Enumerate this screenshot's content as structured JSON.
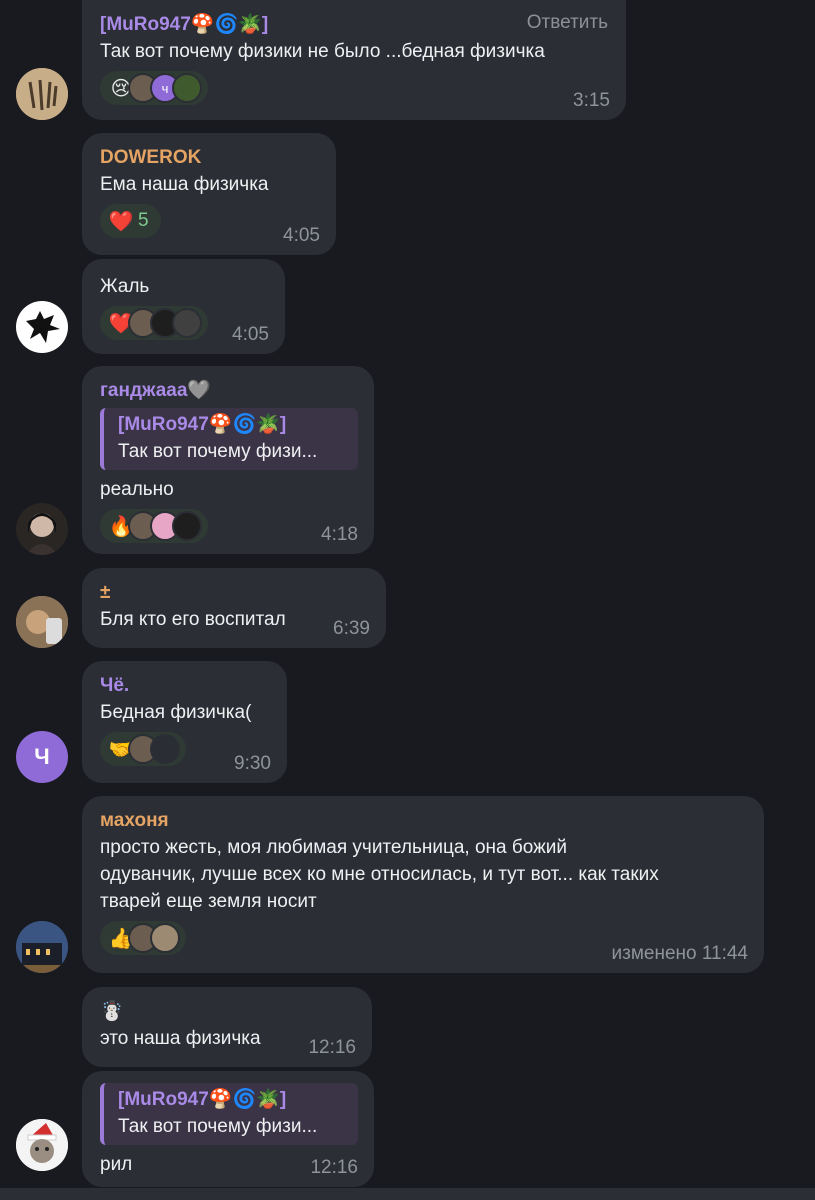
{
  "colors": {
    "background": "#181a1f",
    "bubble": "#2b2e34",
    "author_purple": "#a98ae6",
    "author_orange": "#e5a464",
    "time": "#8f939a"
  },
  "reply_label": "Ответить",
  "messages": [
    {
      "author": "[MuRo947",
      "author_emojis": [
        "🍄",
        "🌀",
        "🪴",
        "]"
      ],
      "text": "Так вот почему физики не было ...бедная физичка",
      "reaction_emoji": "😢",
      "time": "3:15",
      "mini_label": "ч"
    },
    {
      "author": "DOWEROK",
      "text": "Ема наша физичка",
      "reaction_emoji": "❤️",
      "reaction_count": "5",
      "time": "4:05"
    },
    {
      "text": "Жаль",
      "reaction_emoji": "❤️",
      "time": "4:05"
    },
    {
      "author": "ганджааа",
      "author_emoji": "🩶",
      "quote_author": "[MuRo947",
      "quote_emojis": [
        "🍄",
        "🌀",
        "🪴",
        "]"
      ],
      "quote_text": "Так вот почему физи...",
      "text": "реально",
      "reaction_emoji": "🔥",
      "time": "4:18"
    },
    {
      "author": "±",
      "text": "Бля кто его воспитал",
      "time": "6:39"
    },
    {
      "author": "Чё.",
      "text": "Бедная физичка(",
      "reaction_emoji": "🤝",
      "time": "9:30",
      "avatar_letter": "Ч"
    },
    {
      "author": "махоня",
      "text": "просто жесть, моя любимая учительница, она божий\nодуванчик, лучше всех ко мне относилась, и тут вот... как таких\nтварей еще земля носит",
      "reaction_emoji": "👍",
      "time": "изменено 11:44"
    },
    {
      "author_emoji": "☃️",
      "text": "это наша физичка",
      "time": "12:16"
    },
    {
      "quote_author": "[MuRo947",
      "quote_emojis": [
        "🍄",
        "🌀",
        "🪴",
        "]"
      ],
      "quote_text": "Так вот почему физи...",
      "text": "рил",
      "time": "12:16"
    }
  ]
}
